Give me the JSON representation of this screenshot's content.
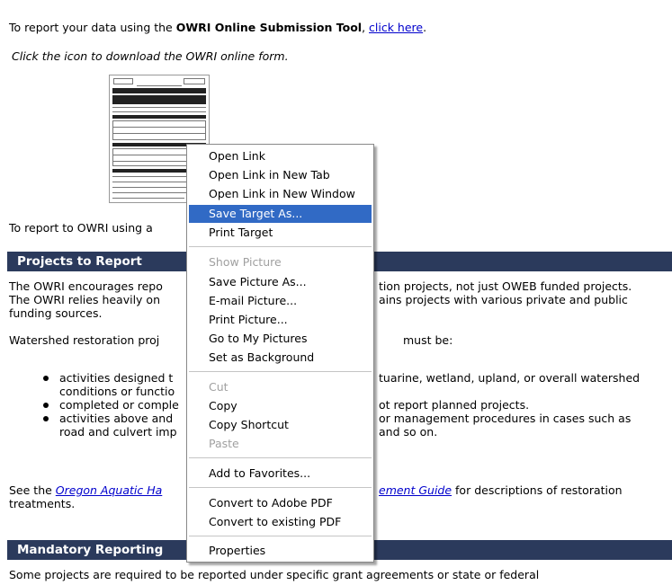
{
  "intro": {
    "report_prefix": "To report your data using the ",
    "tool_name": "OWRI Online Submission Tool",
    "comma": ", ",
    "click_here": "click here",
    "period": ".",
    "download_hint": "Click the icon to download the OWRI online form.",
    "report_using": "To report to OWRI using a"
  },
  "projects_section": {
    "heading": "Projects to Report",
    "p1_line1_left": "The OWRI encourages repo",
    "p1_line1_right": "tion projects, not just OWEB funded projects.",
    "p1_line2_left": "The OWRI relies heavily on",
    "p1_line2_right": "ains projects with various private and public",
    "p1_line3": "funding sources.",
    "p2_left": "Watershed restoration proj",
    "p2_right": "must be:",
    "bullets": [
      {
        "left": "activities designed t",
        "right": "tuarine, wetland, upland, or overall watershed"
      },
      {
        "left": "conditions or functio",
        "right": ""
      },
      {
        "left": "completed or comple",
        "right": "ot report planned projects."
      },
      {
        "left": "activities above and",
        "right": "or management procedures in cases such as"
      },
      {
        "left": "road and culvert imp",
        "right": "and so on."
      }
    ],
    "see_prefix": "See the ",
    "guide_link_left": "Oregon Aquatic Ha",
    "guide_link_right": "ement Guide",
    "see_suffix": " for descriptions of restoration",
    "see_line2": "treatments."
  },
  "mandatory_section": {
    "heading": "Mandatory Reporting",
    "p1": "Some projects are required to be reported under specific grant agreements or state or federal"
  },
  "context_menu": {
    "items": [
      {
        "label": "Open Link"
      },
      {
        "label": "Open Link in New Tab"
      },
      {
        "label": "Open Link in New Window"
      },
      {
        "label": "Save Target As..."
      },
      {
        "label": "Print Target"
      },
      {
        "label": "Show Picture"
      },
      {
        "label": "Save Picture As..."
      },
      {
        "label": "E-mail Picture..."
      },
      {
        "label": "Print Picture..."
      },
      {
        "label": "Go to My Pictures"
      },
      {
        "label": "Set as Background"
      },
      {
        "label": "Cut"
      },
      {
        "label": "Copy"
      },
      {
        "label": "Copy Shortcut"
      },
      {
        "label": "Paste"
      },
      {
        "label": "Add to Favorites..."
      },
      {
        "label": "Convert to Adobe PDF"
      },
      {
        "label": "Convert to existing PDF"
      },
      {
        "label": "Properties"
      }
    ],
    "selected_item": "Save Target As...",
    "disabled_items": [
      "Show Picture",
      "Cut",
      "Paste"
    ],
    "highlight_color": "#316ac5"
  },
  "colors": {
    "section_bar": "#2b3a5c",
    "link": "#0000cc"
  }
}
